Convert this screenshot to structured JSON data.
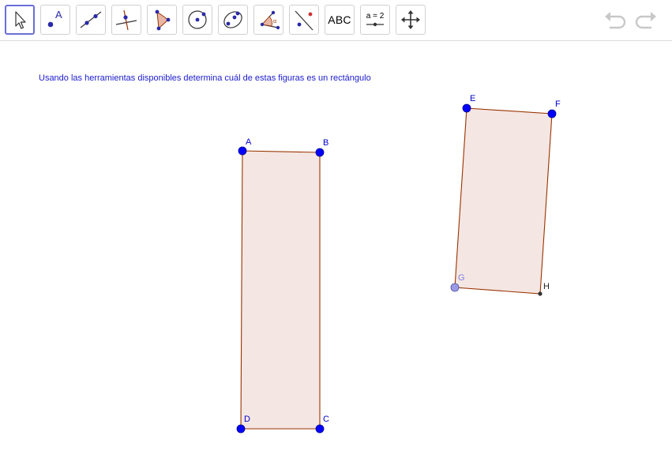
{
  "toolbar": {
    "tools": [
      {
        "name": "move-tool",
        "icon": "arrow-cursor-icon"
      },
      {
        "name": "point-tool",
        "icon": "point-icon",
        "glyph": "A"
      },
      {
        "name": "line-tool",
        "icon": "line-through-two-points-icon"
      },
      {
        "name": "perpendicular-line-tool",
        "icon": "perpendicular-line-icon"
      },
      {
        "name": "polygon-tool",
        "icon": "polygon-icon"
      },
      {
        "name": "circle-center-point-tool",
        "icon": "circle-center-point-icon"
      },
      {
        "name": "conic-through-points-tool",
        "icon": "ellipse-icon"
      },
      {
        "name": "angle-tool",
        "icon": "angle-icon"
      },
      {
        "name": "reflect-about-line-tool",
        "icon": "reflect-line-icon"
      },
      {
        "name": "text-tool",
        "label": "ABC"
      },
      {
        "name": "slider-tool",
        "label": "a = 2"
      },
      {
        "name": "move-graphics-view-tool",
        "icon": "move-arrows-icon"
      }
    ],
    "undo_icon": "undo-icon",
    "redo_icon": "redo-icon"
  },
  "instruction": "Usando las herramientas disponibles determina cuál de estas figuras es un rectángulo",
  "figures": {
    "points": {
      "A": "A",
      "B": "B",
      "C": "C",
      "D": "D",
      "E": "E",
      "F": "F",
      "G": "G",
      "H": "H"
    }
  },
  "colors": {
    "point_blue": "#0000ff",
    "point_light": "#9a9ae6",
    "point_dark": "#333333",
    "edge": "#993300",
    "fill": "#f4e6e2",
    "label_blue": "#0000cc",
    "label_light": "#8080e0",
    "active_border": "#6a6fd8"
  }
}
